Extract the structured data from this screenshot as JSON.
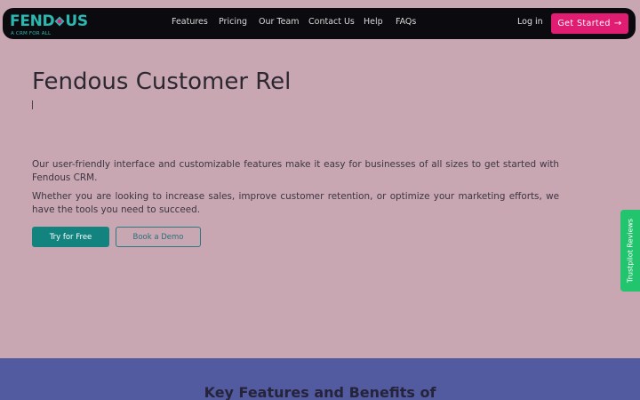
{
  "brand": {
    "name_prefix": "FEND",
    "name_suffix": "US",
    "tagline": "A CRM FOR ALL",
    "accent_color": "#2ab8b0"
  },
  "nav": {
    "links": [
      {
        "label": "Features"
      },
      {
        "label": "Pricing"
      },
      {
        "label": "Our Team"
      },
      {
        "label": "Contact Us"
      },
      {
        "label": "Help"
      },
      {
        "label": "FAQs"
      }
    ],
    "login_label": "Log in",
    "cta_label": "Get Started",
    "cta_icon": "arrow-right-icon",
    "cta_color": "#e01c73"
  },
  "hero": {
    "title": "Fendous Customer Rel",
    "paragraph_1": "Our user-friendly interface and customizable features make it easy for businesses of all sizes to get started with Fendous CRM.",
    "paragraph_2": "Whether you are looking to increase sales, improve customer retention, or optimize your marketing efforts, we have the tools you need to succeed.",
    "primary_button": "Try for Free",
    "secondary_button": "Book a Demo",
    "primary_color": "#138380",
    "background_color": "#c8a6b2"
  },
  "trustpilot": {
    "label": "Trustpilot Reviews",
    "color": "#22c46d"
  },
  "features": {
    "title": "Key Features and Benefits of",
    "background_color": "#525aa0"
  }
}
